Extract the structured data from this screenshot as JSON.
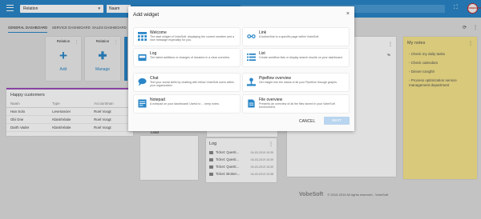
{
  "topbar": {
    "relation_select": "Relation",
    "naam_field": "Naam",
    "avatar_text": "VOBESOFT"
  },
  "tabs": [
    "GENERAL DASHBOARD",
    "SERVICE DASHBOARD",
    "SALES DASHBOARD"
  ],
  "tiles": [
    {
      "title": "Relation",
      "action": "Add"
    },
    {
      "title": "Relation",
      "action": "Manage"
    }
  ],
  "customers": {
    "title": "Happy customers",
    "columns": [
      "Naam",
      "Type",
      "Accountman"
    ],
    "rows": [
      [
        "Han Solo",
        "Leverancier",
        "Roel Voogt"
      ],
      [
        "Obi One",
        "Klant/relatie",
        "Roel Voogt"
      ],
      [
        "Darth Vader",
        "Klant/relatie",
        "Roel Voogt"
      ]
    ]
  },
  "lead_text": "Lead",
  "right_card_pct": "%",
  "notes": {
    "title": "My notes",
    "items": [
      "- Check my daily tasks",
      "- Check calendars",
      "- Dinner tonight!",
      "- Process optimization service management department"
    ]
  },
  "log_card": {
    "title": "Log",
    "rows": [
      {
        "text": "Ticket: Questi...",
        "date": "04-03-2019 15:39"
      },
      {
        "text": "Ticket: Questi...",
        "date": "04-03-2019 15:39"
      },
      {
        "text": "Ticket: Questi...",
        "date": "04-03-2019 15:39"
      },
      {
        "text": "Ticket: Broken...",
        "date": "04-03-2019 15:38"
      }
    ]
  },
  "footer": {
    "logo": "VobeSoft",
    "text": "© 2013-2019 All rights reserved - VobeSoft"
  },
  "modal": {
    "title": "Add widget",
    "cancel": "CANCEL",
    "next": "NEXT",
    "widgets": [
      {
        "name": "Welcome",
        "desc": "The start widget of VobeSoft, displaying the current weather and a nice message especially for you.",
        "icon": "grid-icon"
      },
      {
        "name": "Link",
        "desc": "A button/link to a specific page within VobeSoft.",
        "icon": "link-icon"
      },
      {
        "name": "Log",
        "desc": "The latest additions or changes of dossiers in a clear overview.",
        "icon": "inbox-icon"
      },
      {
        "name": "List",
        "desc": "Create workflow lists or display search results on your dashboard.",
        "icon": "list-icon"
      },
      {
        "name": "Chat",
        "desc": "Text your social skills by chatting with fellow VobeSoft users within your organization.",
        "icon": "chat-icon"
      },
      {
        "name": "Pipeflow overview",
        "desc": "Get insight into the status of all your Pipeflow through graphs.",
        "icon": "pipeflow-icon"
      },
      {
        "name": "Notepad",
        "desc": "A notepad on your dashboard! Useful to ... keep notes.",
        "icon": "notepad-icon"
      },
      {
        "name": "File overview",
        "desc": "Presents an overview of all the files stored in your VobeSoft environment.",
        "icon": "file-icon"
      }
    ]
  }
}
